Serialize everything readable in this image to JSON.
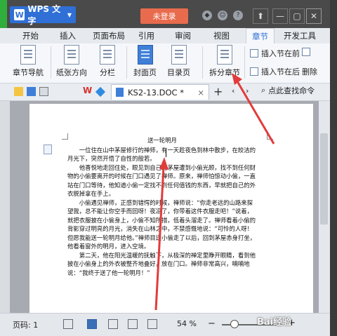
{
  "app": {
    "name": "WPS 文字",
    "login_label": "未登录"
  },
  "tabs": [
    {
      "label": "开始"
    },
    {
      "label": "插入"
    },
    {
      "label": "页面布局"
    },
    {
      "label": "引用"
    },
    {
      "label": "审阅"
    },
    {
      "label": "视图"
    },
    {
      "label": "章节",
      "active": true
    },
    {
      "label": "开发工具"
    }
  ],
  "ribbon": {
    "chapter_nav": "章节导航",
    "paper_direction": "纸张方向",
    "columns": "分栏",
    "cover_page": "封面页",
    "toc_page": "目录页",
    "split_chapter": "拆分章节",
    "insert_section_before": "插入节在前",
    "insert_section_after": "插入节在后",
    "delete_label": "删除"
  },
  "document_tab": {
    "name": "KS2-13.DOC *"
  },
  "find": {
    "label": "点此查找命令"
  },
  "document": {
    "title": "送一轮明月",
    "paragraphs": [
      "一位住在山中茅屋修行的禅师，有一天趁夜色到林中散步，在皎洁的月光下，突然开悟了自性的般若。",
      "他喜悦地走回住处，眼见到自己的茅屋遭到小偷光顾，找不到任何财物的小偷要离开的时候在门口遇见了禅师。原来，禅师怕惊动小偷，一直站在门口等待，他知道小偷一定找不到任何值钱的东西，早就把自己的外衣脱掉拿在手上。",
      "小偷遇见禅师，正感到错愕的时候，禅师说：“你走老远的山路来探望我，总不能让你空手而回呀！夜凉了，你带着这件衣服走吧！”说着，就把衣服披在小偷身上，小偷不知所措，低着头溜走了。禅师看着小偷的背影穿过明亮的月光，消失在山林之中，不禁感慨地说：“可怜的人呀！但愿我能送一轮明月给他。”禅师目送小偷走了以后，回到茅屋赤身打坐，他看着窗外的明月，进入空境。",
      "第二天，他在阳光温暖的抚触下，从极深的禅定里睁开眼睛，看到他披在小偷身上的外衣被整齐地叠好，放在门口。禅师非常高兴，喃喃地说：“我终于送了他一轮明月！”"
    ]
  },
  "status": {
    "page_label": "页码: 1",
    "zoom": "54 %"
  },
  "watermark": "Bai经验",
  "colors": {
    "accent_blue": "#2f6fd6",
    "login_orange": "#e86b4d",
    "arrow_red": "#e23b3b"
  }
}
